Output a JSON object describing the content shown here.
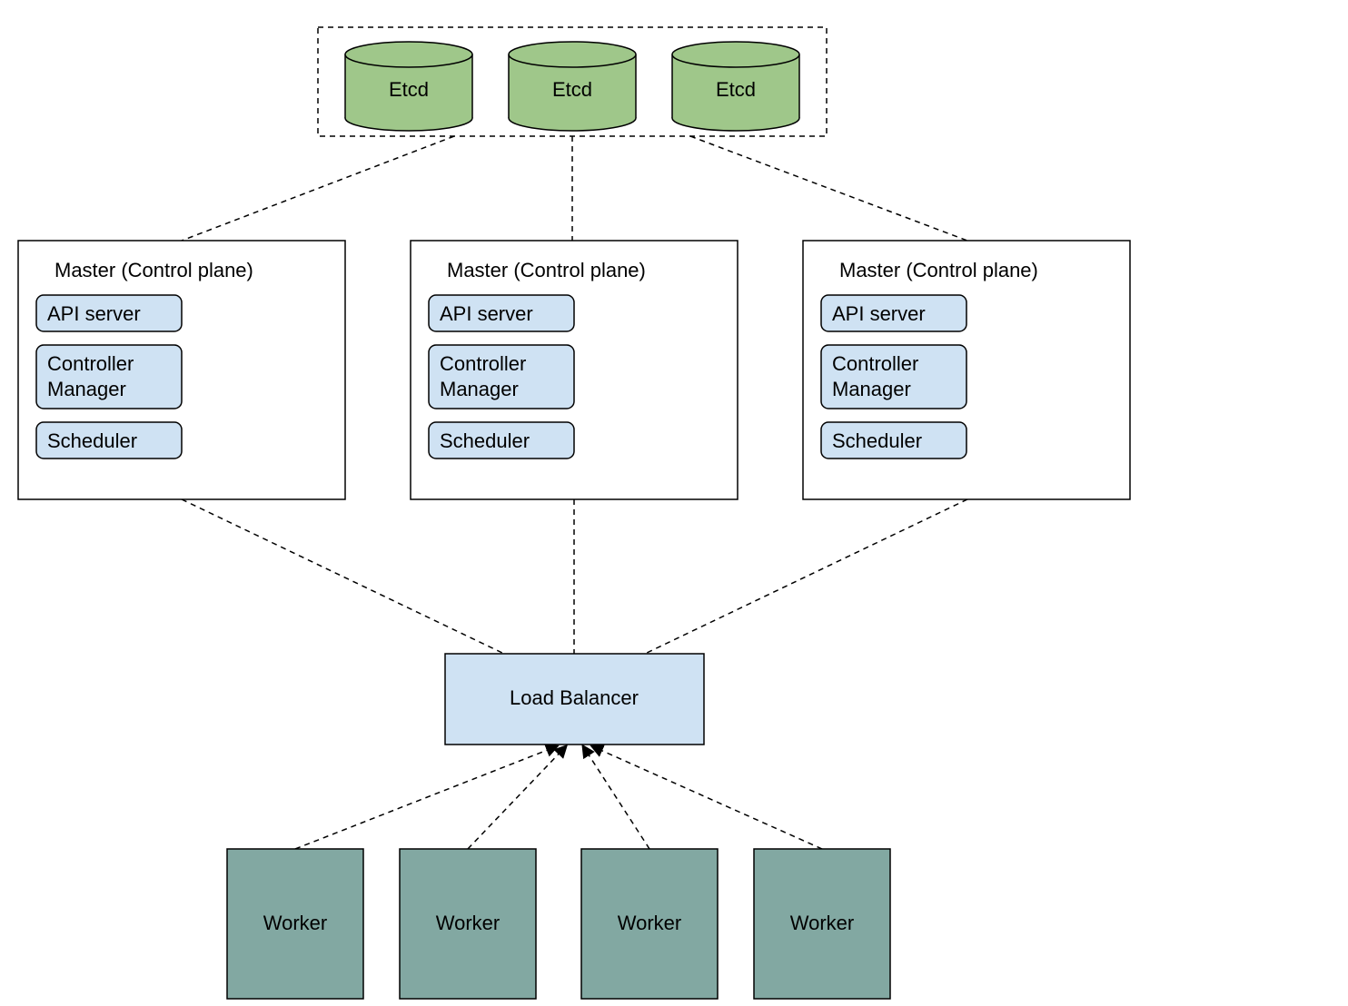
{
  "colors": {
    "etcd_fill": "#9fc78a",
    "etcd_stroke": "#000000",
    "master_box_fill": "#ffffff",
    "component_fill": "#cfe2f3",
    "component_stroke": "#000000",
    "lb_fill": "#cfe2f3",
    "worker_fill": "#82a8a2",
    "dash_stroke": "#000000"
  },
  "etcd_cluster": {
    "nodes": [
      {
        "label": "Etcd"
      },
      {
        "label": "Etcd"
      },
      {
        "label": "Etcd"
      }
    ]
  },
  "masters": [
    {
      "title": "Master (Control plane)",
      "components": [
        "API server",
        "Controller\nManager",
        "Scheduler"
      ]
    },
    {
      "title": "Master (Control plane)",
      "components": [
        "API server",
        "Controller\nManager",
        "Scheduler"
      ]
    },
    {
      "title": "Master (Control plane)",
      "components": [
        "API server",
        "Controller\nManager",
        "Scheduler"
      ]
    }
  ],
  "load_balancer": {
    "label": "Load Balancer"
  },
  "workers": [
    {
      "label": "Worker"
    },
    {
      "label": "Worker"
    },
    {
      "label": "Worker"
    },
    {
      "label": "Worker"
    }
  ]
}
